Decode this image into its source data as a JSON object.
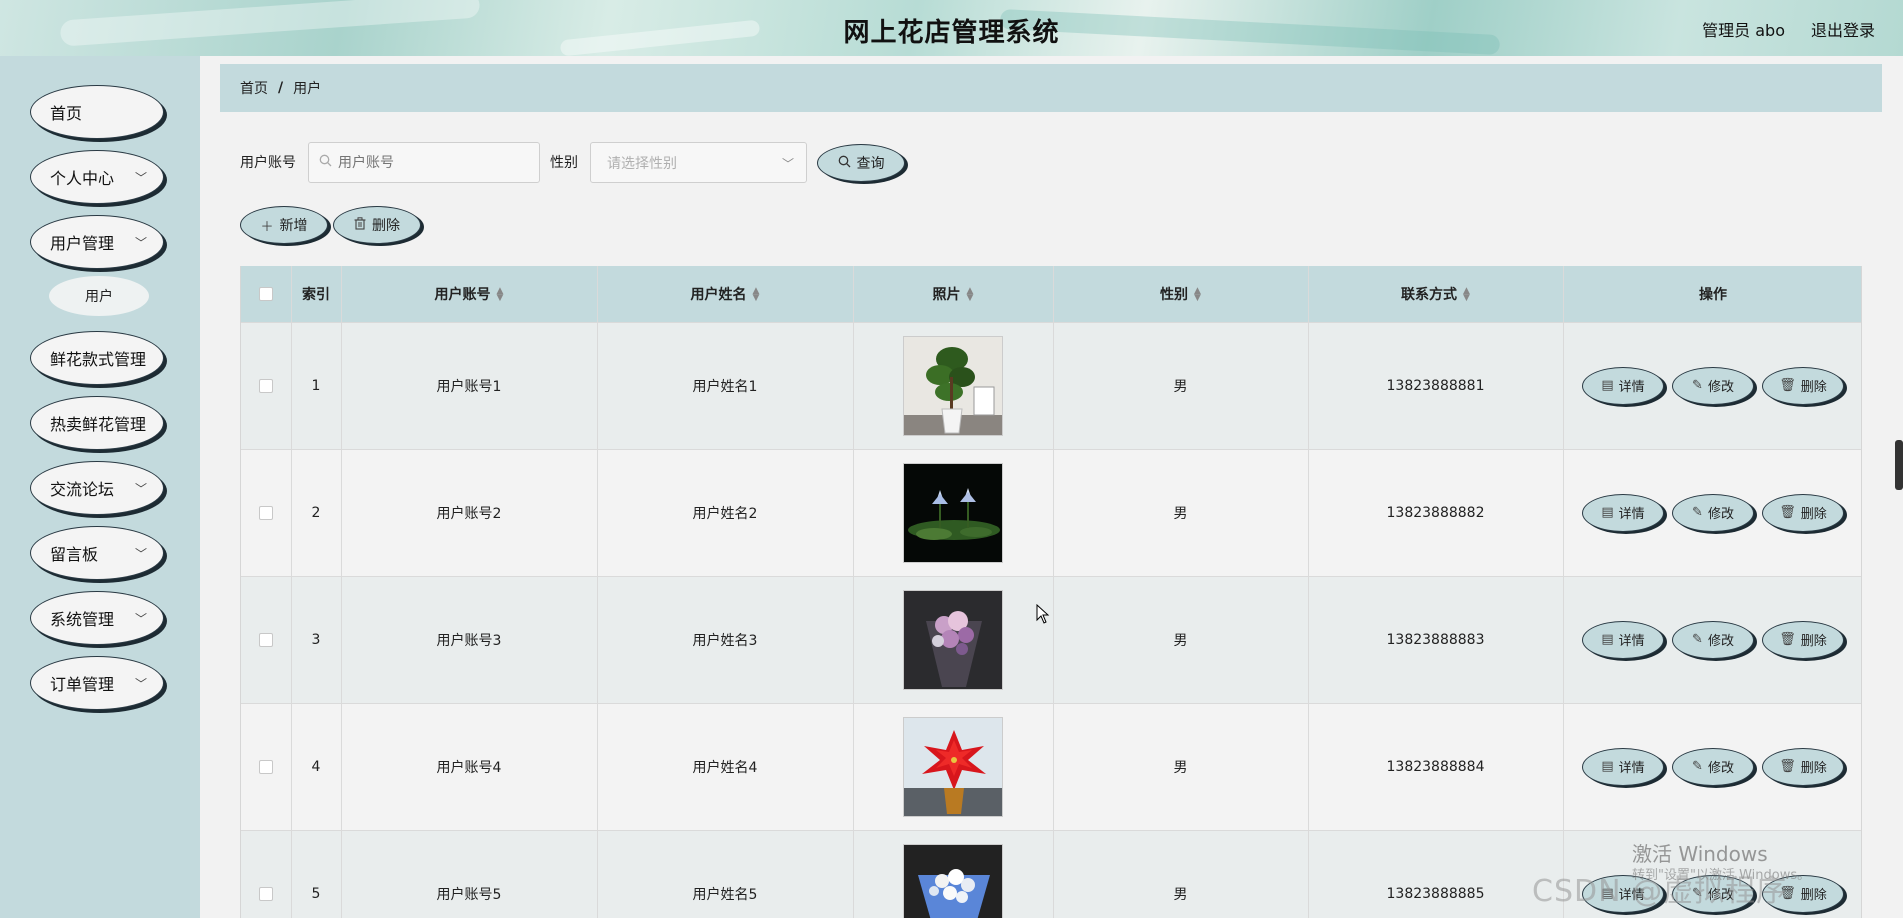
{
  "header": {
    "title": "网上花店管理系统",
    "admin_label": "管理员 abo",
    "logout_label": "退出登录"
  },
  "sidebar": {
    "items": [
      {
        "label": "首页",
        "has_chevron": false
      },
      {
        "label": "个人中心",
        "has_chevron": true
      },
      {
        "label": "用户管理",
        "has_chevron": true
      },
      {
        "label": "鲜花款式管理",
        "has_chevron": false
      },
      {
        "label": "热卖鲜花管理",
        "has_chevron": false
      },
      {
        "label": "交流论坛",
        "has_chevron": true
      },
      {
        "label": "留言板",
        "has_chevron": true
      },
      {
        "label": "系统管理",
        "has_chevron": true
      },
      {
        "label": "订单管理",
        "has_chevron": true
      }
    ],
    "sub_item": "用户"
  },
  "breadcrumb": {
    "home": "首页",
    "sep": "/",
    "current": "用户"
  },
  "search": {
    "account_label": "用户账号",
    "account_placeholder": "用户账号",
    "gender_label": "性别",
    "gender_placeholder": "请选择性别",
    "query_label": "查询"
  },
  "actions": {
    "add_label": "新增",
    "delete_label": "删除"
  },
  "table": {
    "headers": {
      "index": "索引",
      "account": "用户账号",
      "name": "用户姓名",
      "photo": "照片",
      "gender": "性别",
      "phone": "联系方式",
      "ops": "操作"
    },
    "ops": {
      "detail": "详情",
      "edit": "修改",
      "delete": "删除"
    },
    "rows": [
      {
        "index": "1",
        "account": "用户账号1",
        "name": "用户姓名1",
        "gender": "男",
        "phone": "13823888881",
        "photo": "potted-plant"
      },
      {
        "index": "2",
        "account": "用户账号2",
        "name": "用户姓名2",
        "gender": "男",
        "phone": "13823888882",
        "photo": "water-lily"
      },
      {
        "index": "3",
        "account": "用户账号3",
        "name": "用户姓名3",
        "gender": "男",
        "phone": "13823888883",
        "photo": "bouquet-purple"
      },
      {
        "index": "4",
        "account": "用户账号4",
        "name": "用户姓名4",
        "gender": "男",
        "phone": "13823888884",
        "photo": "poinsettia"
      },
      {
        "index": "5",
        "account": "用户账号5",
        "name": "用户姓名5",
        "gender": "男",
        "phone": "13823888885",
        "photo": "bouquet-blue"
      }
    ]
  },
  "watermark": {
    "activate": "激活 Windows",
    "activate_sub": "转到\"设置\"以激活 Windows。",
    "csdn": "CSDN @虚拟程序"
  },
  "colors": {
    "accent": "#c3dadd",
    "button_shadow": "#1d2b33"
  }
}
